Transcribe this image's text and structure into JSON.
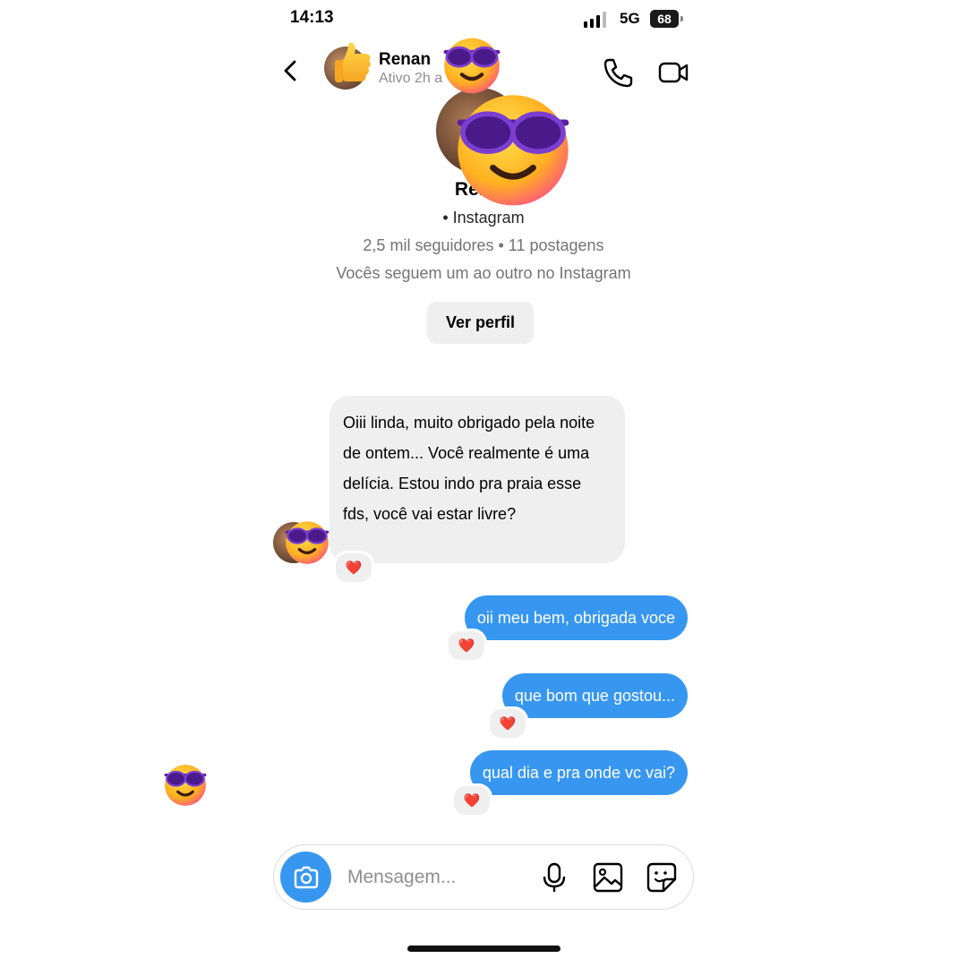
{
  "status_bar": {
    "time": "14:13",
    "network": "5G",
    "battery": "68"
  },
  "header": {
    "name": "Renan",
    "status": "Ativo 2h a"
  },
  "profile": {
    "name": "Renan",
    "platform": "• Instagram",
    "stats": "2,5 mil seguidores • 11 postagens",
    "follow_note": "Vocês seguem um ao outro no Instagram",
    "view_profile_label": "Ver perfil"
  },
  "messages": {
    "incoming": [
      {
        "text": "Oiii linda, muito obrigado pela noite de ontem... Você realmente é uma delícia. Estou indo pra praia esse fds, você vai estar livre?",
        "reaction": "❤️"
      }
    ],
    "outgoing": [
      {
        "text": "oii meu bem, obrigada voce",
        "reaction": "❤️"
      },
      {
        "text": "que bom que gostou...",
        "reaction": "❤️"
      },
      {
        "text": "qual dia e pra onde vc vai?",
        "reaction": "❤️"
      }
    ]
  },
  "composer": {
    "placeholder": "Mensagem..."
  },
  "icons": [
    "back-icon",
    "phone-icon",
    "video-icon",
    "camera-icon",
    "microphone-icon",
    "gallery-icon",
    "sticker-icon",
    "heart-icon",
    "sunglasses-emoji-sticker",
    "thumbs-up-emoji-sticker"
  ],
  "colors": {
    "accent": "#3797f0",
    "incoming_bubble": "#efefef",
    "sticker_yellow": "#ffc83d",
    "sticker_glasses": "#6b2fb3"
  }
}
